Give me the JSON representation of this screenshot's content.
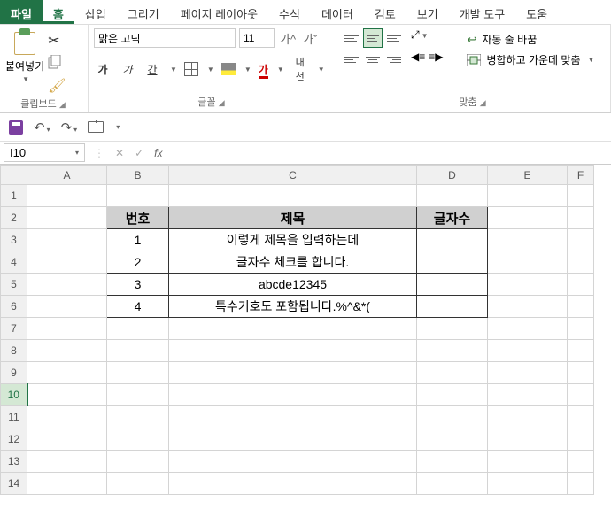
{
  "menu": {
    "file": "파일",
    "home": "홈",
    "insert": "삽입",
    "draw": "그리기",
    "layout": "페이지 레이아웃",
    "formulas": "수식",
    "data": "데이터",
    "review": "검토",
    "view": "보기",
    "dev": "개발 도구",
    "help": "도움"
  },
  "ribbon": {
    "clipboard": {
      "label": "클립보드",
      "paste": "붙여넣기"
    },
    "font": {
      "label": "글꼴",
      "name": "맑은 고딕",
      "size": "11",
      "bold": "가",
      "italic": "가",
      "underline": "간",
      "color": "가",
      "vert": "내천"
    },
    "align": {
      "label": "맞춤",
      "wrap": "자동 줄 바꿈",
      "merge": "병합하고 가운데 맞춤"
    }
  },
  "namebox": {
    "ref": "I10",
    "fx": "fx"
  },
  "columns": [
    "A",
    "B",
    "C",
    "D",
    "E",
    "F"
  ],
  "rows": [
    "1",
    "2",
    "3",
    "4",
    "5",
    "6",
    "7",
    "8",
    "9",
    "10",
    "11",
    "12",
    "13",
    "14"
  ],
  "activeRow": "10",
  "table": {
    "headers": {
      "num": "번호",
      "title": "제목",
      "len": "글자수"
    },
    "rows": [
      {
        "num": "1",
        "title": "이렇게 제목을 입력하는데",
        "len": ""
      },
      {
        "num": "2",
        "title": "글자수 체크를 합니다.",
        "len": ""
      },
      {
        "num": "3",
        "title": "abcde12345",
        "len": ""
      },
      {
        "num": "4",
        "title": "특수기호도 포함됩니다.%^&*(",
        "len": ""
      }
    ]
  }
}
